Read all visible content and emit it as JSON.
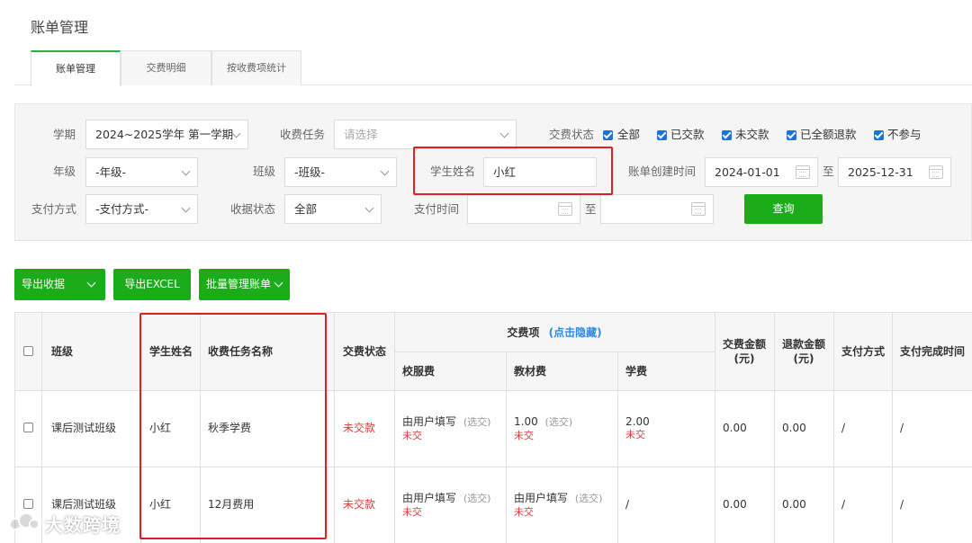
{
  "page_title": "账单管理",
  "tabs": [
    {
      "label": "账单管理",
      "active": true
    },
    {
      "label": "交费明细",
      "active": false
    },
    {
      "label": "按收费项统计",
      "active": false
    }
  ],
  "filters": {
    "term_label": "学期",
    "term_value": "2024~2025学年 第一学期",
    "task_label": "收费任务",
    "task_placeholder": "请选择",
    "pay_status_label": "交费状态",
    "pay_status_options": [
      {
        "label": "全部",
        "checked": true
      },
      {
        "label": "已交款",
        "checked": true
      },
      {
        "label": "未交款",
        "checked": true
      },
      {
        "label": "已全额退款",
        "checked": true
      },
      {
        "label": "不参与",
        "checked": true
      }
    ],
    "grade_label": "年级",
    "grade_value": "-年级-",
    "class_label": "班级",
    "class_value": "-班级-",
    "student_label": "学生姓名",
    "student_value": "小红",
    "created_label": "账单创建时间",
    "created_from": "2024-01-01",
    "to_label": "至",
    "created_to": "2025-12-31",
    "pay_method_label": "支付方式",
    "pay_method_value": "-支付方式-",
    "receipt_label": "收据状态",
    "receipt_value": "全部",
    "pay_time_label": "支付时间",
    "pay_time_from": "",
    "pay_time_to": "",
    "query_button": "查询"
  },
  "actions": {
    "export_receipt": "导出收据",
    "export_excel": "导出EXCEL",
    "batch_manage": "批量管理账单"
  },
  "table": {
    "headers": {
      "class": "班级",
      "student": "学生姓名",
      "task": "收费任务名称",
      "status": "交费状态",
      "items_group": "交费项",
      "items_toggle": "(点击隐藏)",
      "item1": "校服费",
      "item2": "教材费",
      "item3": "学费",
      "amount_line1": "交费金额",
      "amount_line2": "(元)",
      "refund_line1": "退款金额",
      "refund_line2": "(元)",
      "method": "支付方式",
      "done_time": "支付完成时间"
    },
    "rows": [
      {
        "class": "课后测试班级",
        "student": "小红",
        "task": "秋季学费",
        "status": "未交款",
        "item1": {
          "main": "由用户填写",
          "opt": "(选交)",
          "state": "未交"
        },
        "item2": {
          "main": "1.00",
          "opt": "(选交)",
          "state": "未交"
        },
        "item3": {
          "main": "2.00",
          "opt": "",
          "state": "未交"
        },
        "amount": "0.00",
        "refund": "0.00",
        "method": "/",
        "done_time": "/"
      },
      {
        "class": "课后测试班级",
        "student": "小红",
        "task": "12月费用",
        "status": "未交款",
        "item1": {
          "main": "由用户填写",
          "opt": "(选交)",
          "state": "未交"
        },
        "item2": {
          "main": "由用户填写",
          "opt": "(选交)",
          "state": "未交"
        },
        "item3": {
          "main": "/",
          "opt": "",
          "state": ""
        },
        "amount": "0.00",
        "refund": "0.00",
        "method": "/",
        "done_time": "/"
      }
    ]
  },
  "watermark": "大数跨境",
  "colors": {
    "accent_green": "#1aad19",
    "checkbox_blue": "#1a73d9",
    "status_red": "#e03c3c",
    "highlight_red": "#e02020",
    "link_blue": "#2f8ae8"
  }
}
